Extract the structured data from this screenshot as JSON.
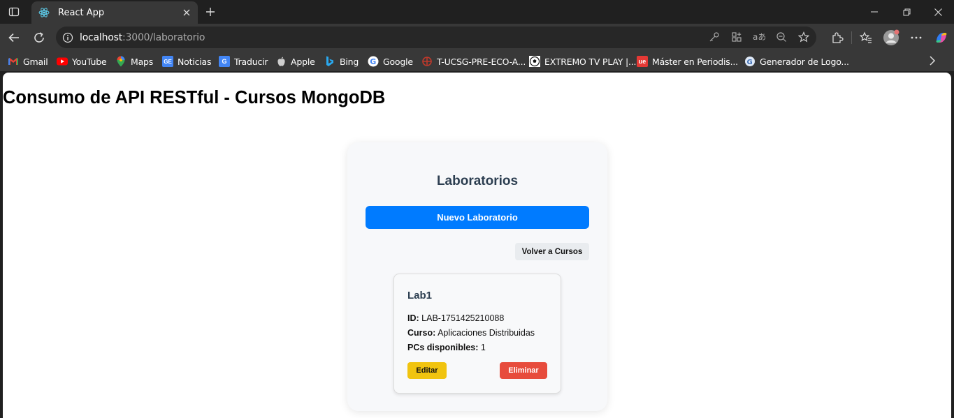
{
  "browser": {
    "tab_title": "React App",
    "url_host": "localhost",
    "url_path": ":3000/laboratorio",
    "bookmarks": [
      {
        "label": "Gmail",
        "icon": "gmail-icon",
        "color": "#ea4335"
      },
      {
        "label": "YouTube",
        "icon": "youtube-icon",
        "color": "#ff0000"
      },
      {
        "label": "Maps",
        "icon": "maps-icon",
        "color": "#34a853"
      },
      {
        "label": "Noticias",
        "icon": "news-icon",
        "color": "#4285f4"
      },
      {
        "label": "Traducir",
        "icon": "translate-icon",
        "color": "#4285f4"
      },
      {
        "label": "Apple",
        "icon": "apple-icon",
        "color": "#cfcfcf"
      },
      {
        "label": "Bing",
        "icon": "bing-icon",
        "color": "#2aa9f0"
      },
      {
        "label": "Google",
        "icon": "google-icon",
        "color": "#ffffff"
      },
      {
        "label": "T-UCSG-PRE-ECO-A...",
        "icon": "ucsg-icon",
        "color": "#c0392b"
      },
      {
        "label": "EXTREMO TV PLAY |...",
        "icon": "soccer-ball-icon",
        "color": "#ffffff"
      },
      {
        "label": "Máster en Periodis...",
        "icon": "unir-icon",
        "color": "#e53935"
      },
      {
        "label": "Generador de Logo...",
        "icon": "logo-generator-icon",
        "color": "#9fc5f8"
      }
    ]
  },
  "page": {
    "title": "Consumo de API RESTful - Cursos MongoDB",
    "panel": {
      "title": "Laboratorios",
      "new_button": "Nuevo Laboratorio",
      "back_button": "Volver a Cursos"
    },
    "labs": [
      {
        "name": "Lab1",
        "id_label": "ID:",
        "id": "LAB-1751425210088",
        "course_label": "Curso:",
        "course": "Aplicaciones Distribuidas",
        "pcs_label": "PCs disponibles:",
        "pcs": "1",
        "edit_button": "Editar",
        "delete_button": "Eliminar"
      }
    ]
  },
  "colors": {
    "primary": "#007bff",
    "edit": "#f1c40f",
    "delete": "#e74c3c",
    "heading": "#2c3e50"
  }
}
